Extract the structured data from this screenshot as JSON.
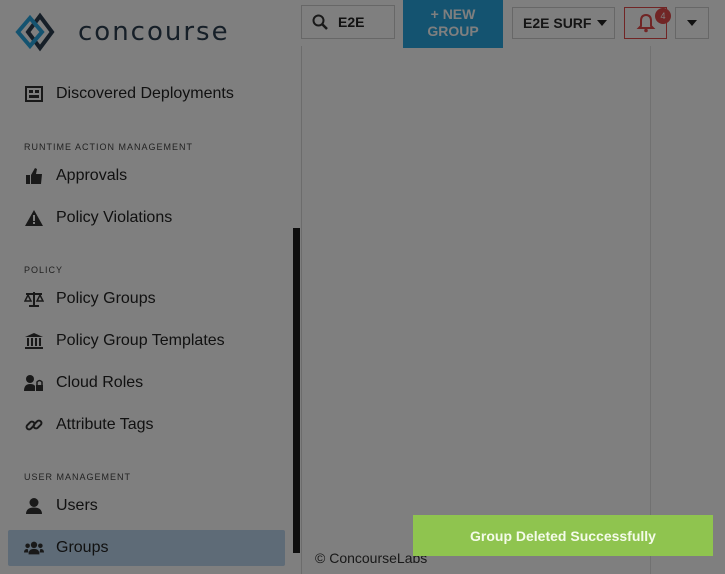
{
  "app": {
    "brand_name": "concourse"
  },
  "header": {
    "search_value": "E2E",
    "new_group_line1": "+ NEW",
    "new_group_line2": "GROUP",
    "environment": "E2E SURF",
    "notification_count": "4"
  },
  "sidebar": {
    "items": [
      {
        "label": "Discovered Deployments",
        "icon": "deployments-icon"
      },
      {
        "label": "Approvals",
        "icon": "thumbs-up-icon"
      },
      {
        "label": "Policy Violations",
        "icon": "warning-icon"
      },
      {
        "label": "Policy Groups",
        "icon": "balance-scale-icon"
      },
      {
        "label": "Policy Group Templates",
        "icon": "institution-icon"
      },
      {
        "label": "Cloud Roles",
        "icon": "user-lock-icon"
      },
      {
        "label": "Attribute Tags",
        "icon": "link-icon"
      },
      {
        "label": "Users",
        "icon": "user-icon"
      },
      {
        "label": "Groups",
        "icon": "users-icon",
        "active": true
      }
    ],
    "sections": {
      "runtime": "RUNTIME ACTION MANAGEMENT",
      "policy": "POLICY",
      "user_mgmt": "USER MANAGEMENT"
    }
  },
  "footer": {
    "copyright": "© ConcourseLabs"
  },
  "toast": {
    "message": "Group Deleted Successfully"
  },
  "colors": {
    "accent": "#29a7e1",
    "toast": "#8fc44f",
    "alert": "#e24a4a",
    "active_bg": "#bcd7ee"
  }
}
